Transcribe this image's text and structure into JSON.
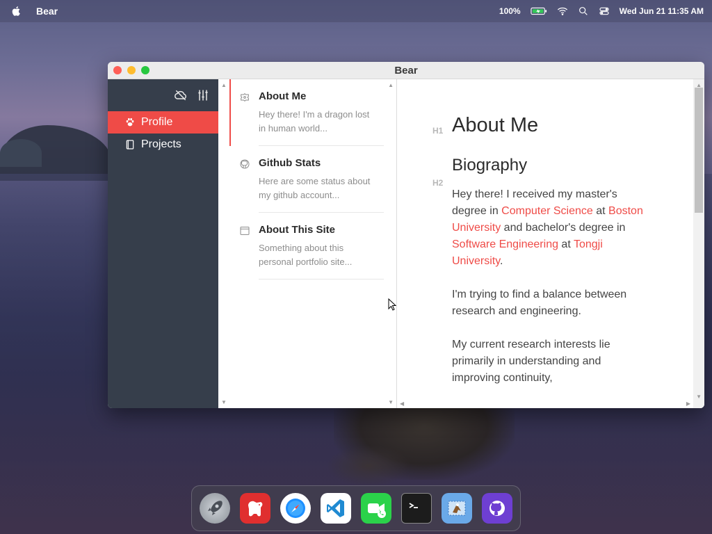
{
  "menubar": {
    "app_name": "Bear",
    "battery": "100%",
    "datetime": "Wed Jun 21  11:35 AM"
  },
  "window": {
    "title": "Bear"
  },
  "sidebar": {
    "items": [
      {
        "label": "Profile",
        "icon": "paw-icon",
        "active": true
      },
      {
        "label": "Projects",
        "icon": "book-icon",
        "active": false
      }
    ]
  },
  "notes": [
    {
      "title": "About Me",
      "snippet": "Hey there! I'm a dragon lost in human world...",
      "icon": "badge-icon"
    },
    {
      "title": "Github Stats",
      "snippet": "Here are some status about my github account...",
      "icon": "github-icon"
    },
    {
      "title": "About This Site",
      "snippet": "Something about this personal portfolio site...",
      "icon": "browser-window-icon"
    }
  ],
  "editor": {
    "h1_label": "H1",
    "h1": "About Me",
    "h2_label": "H2",
    "h2": "Biography",
    "para1": {
      "t1": "Hey there! I received my master's degree in ",
      "link1": "Computer Science",
      "t2": " at ",
      "link2": "Boston University",
      "t3": " and bachelor's degree in ",
      "link3": "Software Engineering",
      "t4": " at ",
      "link4": "Tongji University",
      "t5": "."
    },
    "para2": "I'm trying to find a balance between research and engineering.",
    "para3": "My current research interests lie primarily in understanding and improving continuity,"
  },
  "dock": {
    "apps": [
      "launchpad-icon",
      "bear-app-icon",
      "safari-icon",
      "vscode-icon",
      "facetime-icon",
      "terminal-icon",
      "mail-icon",
      "github-app-icon"
    ]
  },
  "colors": {
    "accent": "#ef4b47",
    "sidebar_bg": "#363e4b"
  }
}
